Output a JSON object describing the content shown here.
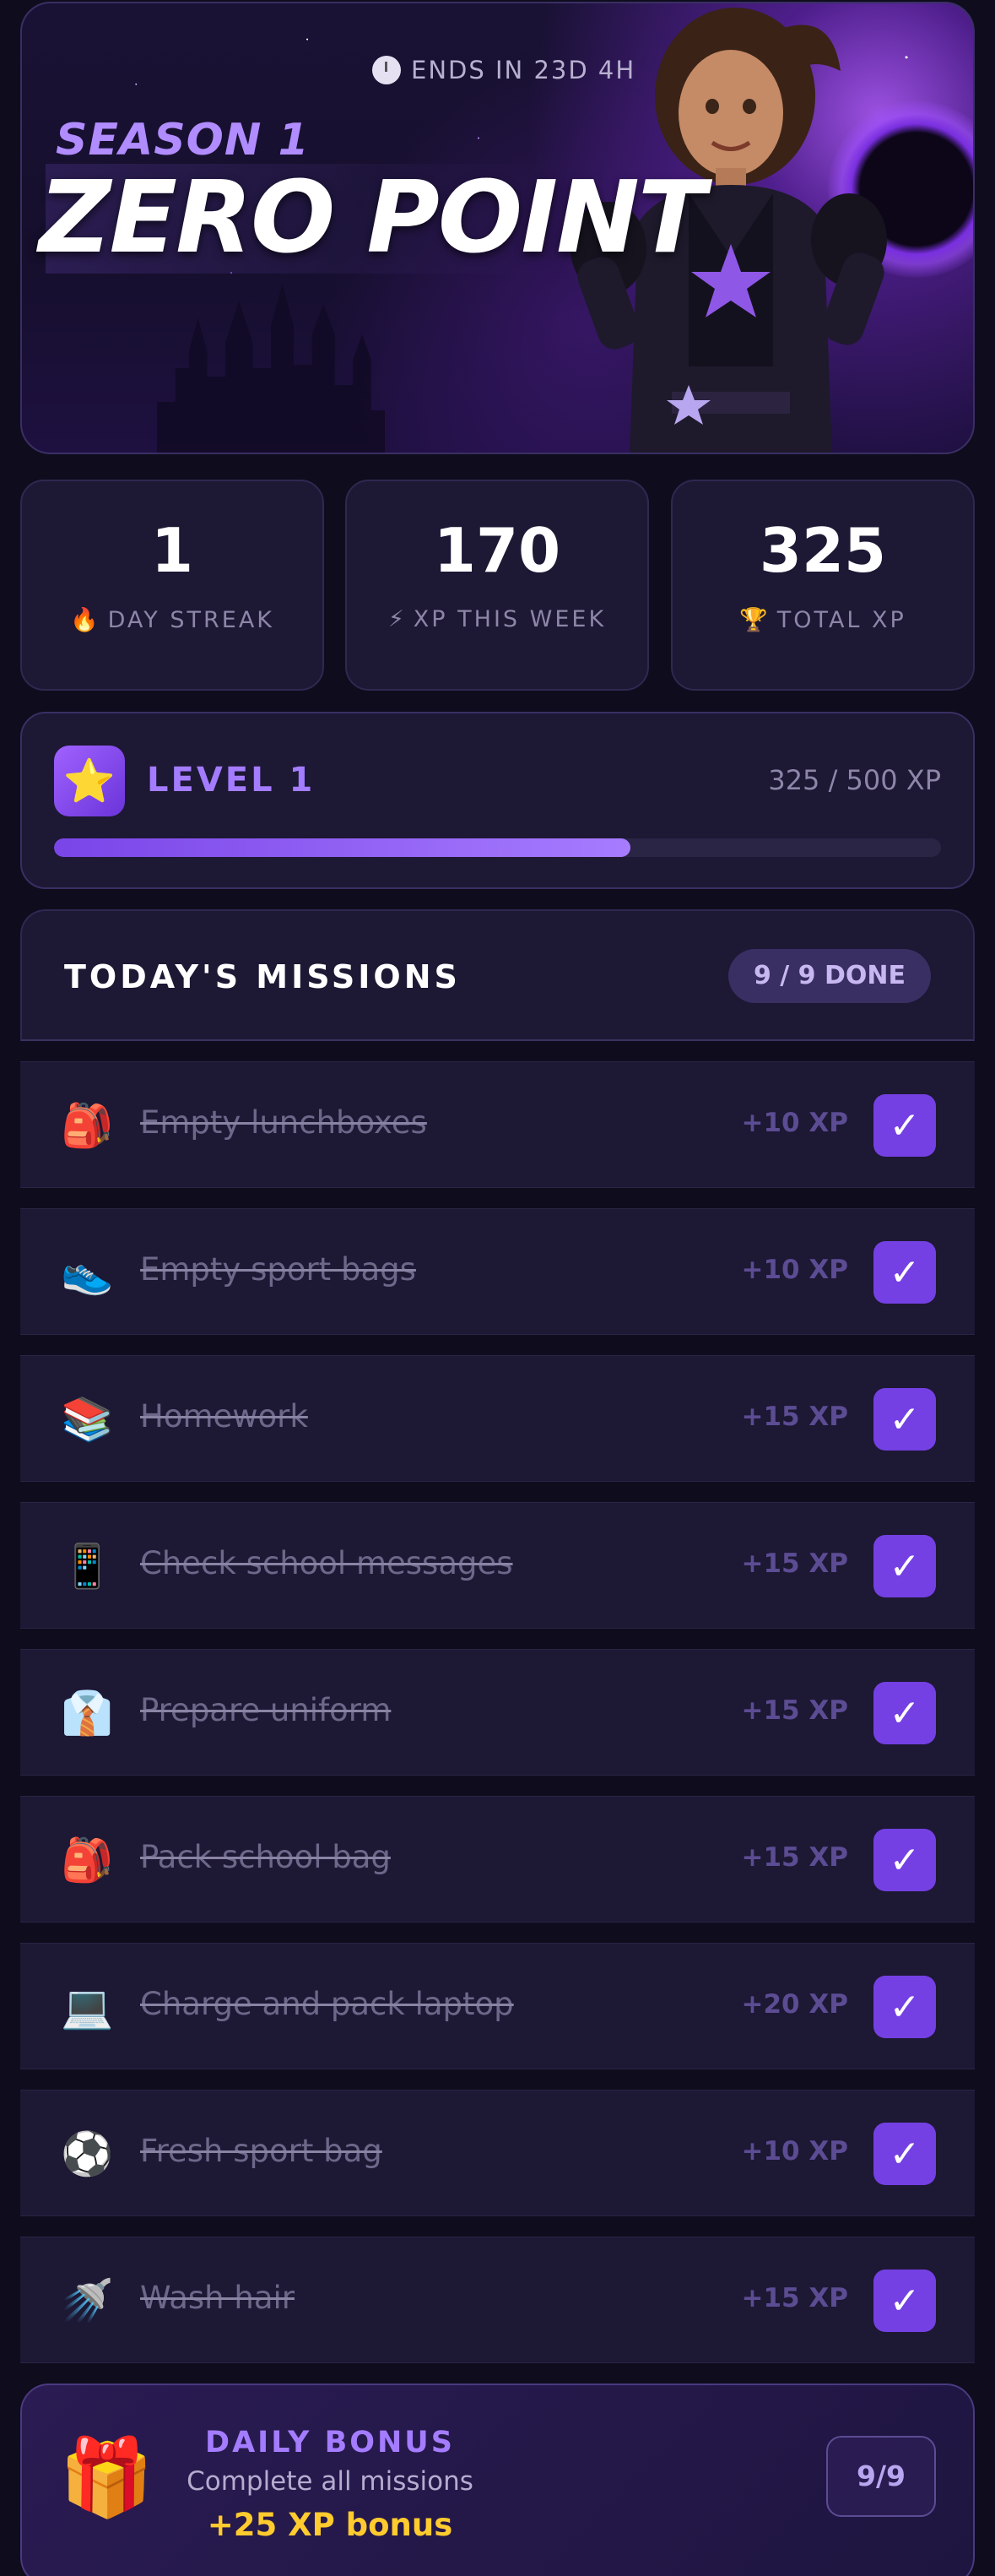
{
  "hero": {
    "timer": "ENDS IN 23D 4H",
    "season": "SEASON 1",
    "title": "ZERO POINT"
  },
  "stats": [
    {
      "value": "1",
      "icon": "🔥",
      "icon_name": "fire-icon",
      "label": "DAY STREAK"
    },
    {
      "value": "170",
      "icon": "⚡",
      "icon_name": "lightning-icon",
      "label": "XP THIS WEEK"
    },
    {
      "value": "325",
      "icon": "🏆",
      "icon_name": "trophy-icon",
      "label": "TOTAL XP"
    }
  ],
  "level": {
    "icon": "⭐",
    "title": "LEVEL 1",
    "xp_text": "325 / 500 XP",
    "progress": 0.65
  },
  "missions": {
    "title": "TODAY'S MISSIONS",
    "done_label": "9 / 9 DONE",
    "check_glyph": "✓",
    "items": [
      {
        "icon": "🎒",
        "name": "Empty lunchboxes",
        "xp": "+10 XP"
      },
      {
        "icon": "👟",
        "name": "Empty sport bags",
        "xp": "+10 XP"
      },
      {
        "icon": "📚",
        "name": "Homework",
        "xp": "+15 XP"
      },
      {
        "icon": "📱",
        "name": "Check school messages",
        "xp": "+15 XP"
      },
      {
        "icon": "👔",
        "name": "Prepare uniform",
        "xp": "+15 XP"
      },
      {
        "icon": "🎒",
        "name": "Pack school bag",
        "xp": "+15 XP"
      },
      {
        "icon": "💻",
        "name": "Charge and pack laptop",
        "xp": "+20 XP"
      },
      {
        "icon": "⚽",
        "name": "Fresh sport bag",
        "xp": "+10 XP"
      },
      {
        "icon": "🚿",
        "name": "Wash hair",
        "xp": "+15 XP"
      }
    ]
  },
  "bonus": {
    "icon": "🎁",
    "title": "DAILY BONUS",
    "subtitle": "Complete all missions",
    "reward": "+25 XP bonus",
    "count": "9/9"
  },
  "colors": {
    "background": "#0f0c1d",
    "card": "#1d1834",
    "accent": "#7440e3",
    "accent_light": "#a47cff",
    "gold": "#ffcb2e"
  }
}
